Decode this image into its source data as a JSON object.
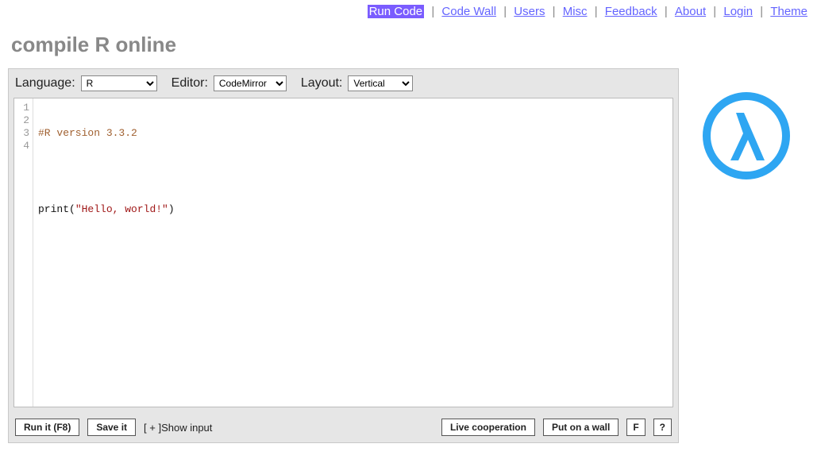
{
  "nav": {
    "items": [
      {
        "label": "Run Code",
        "active": true
      },
      {
        "label": "Code Wall",
        "active": false
      },
      {
        "label": "Users",
        "active": false
      },
      {
        "label": "Misc",
        "active": false
      },
      {
        "label": "Feedback",
        "active": false
      },
      {
        "label": "About",
        "active": false
      },
      {
        "label": "Login",
        "active": false
      },
      {
        "label": "Theme",
        "active": false
      }
    ]
  },
  "page": {
    "title": "compile R online"
  },
  "controls": {
    "language_label": "Language:",
    "language_value": "R",
    "editor_label": "Editor:",
    "editor_value": "CodeMirror",
    "layout_label": "Layout:",
    "layout_value": "Vertical"
  },
  "code": {
    "line1_comment": "#R version 3.3.2",
    "line3_fn": "print",
    "line3_open": "(",
    "line3_str": "\"Hello, world!\"",
    "line3_close": ")",
    "gutter": [
      "1",
      "2",
      "3",
      "4"
    ]
  },
  "buttons": {
    "run": "Run it (F8)",
    "save": "Save it",
    "show_input_prefix": "[ + ] ",
    "show_input": "Show input",
    "live": "Live cooperation",
    "wall": "Put on a wall",
    "f": "F",
    "help": "?"
  }
}
